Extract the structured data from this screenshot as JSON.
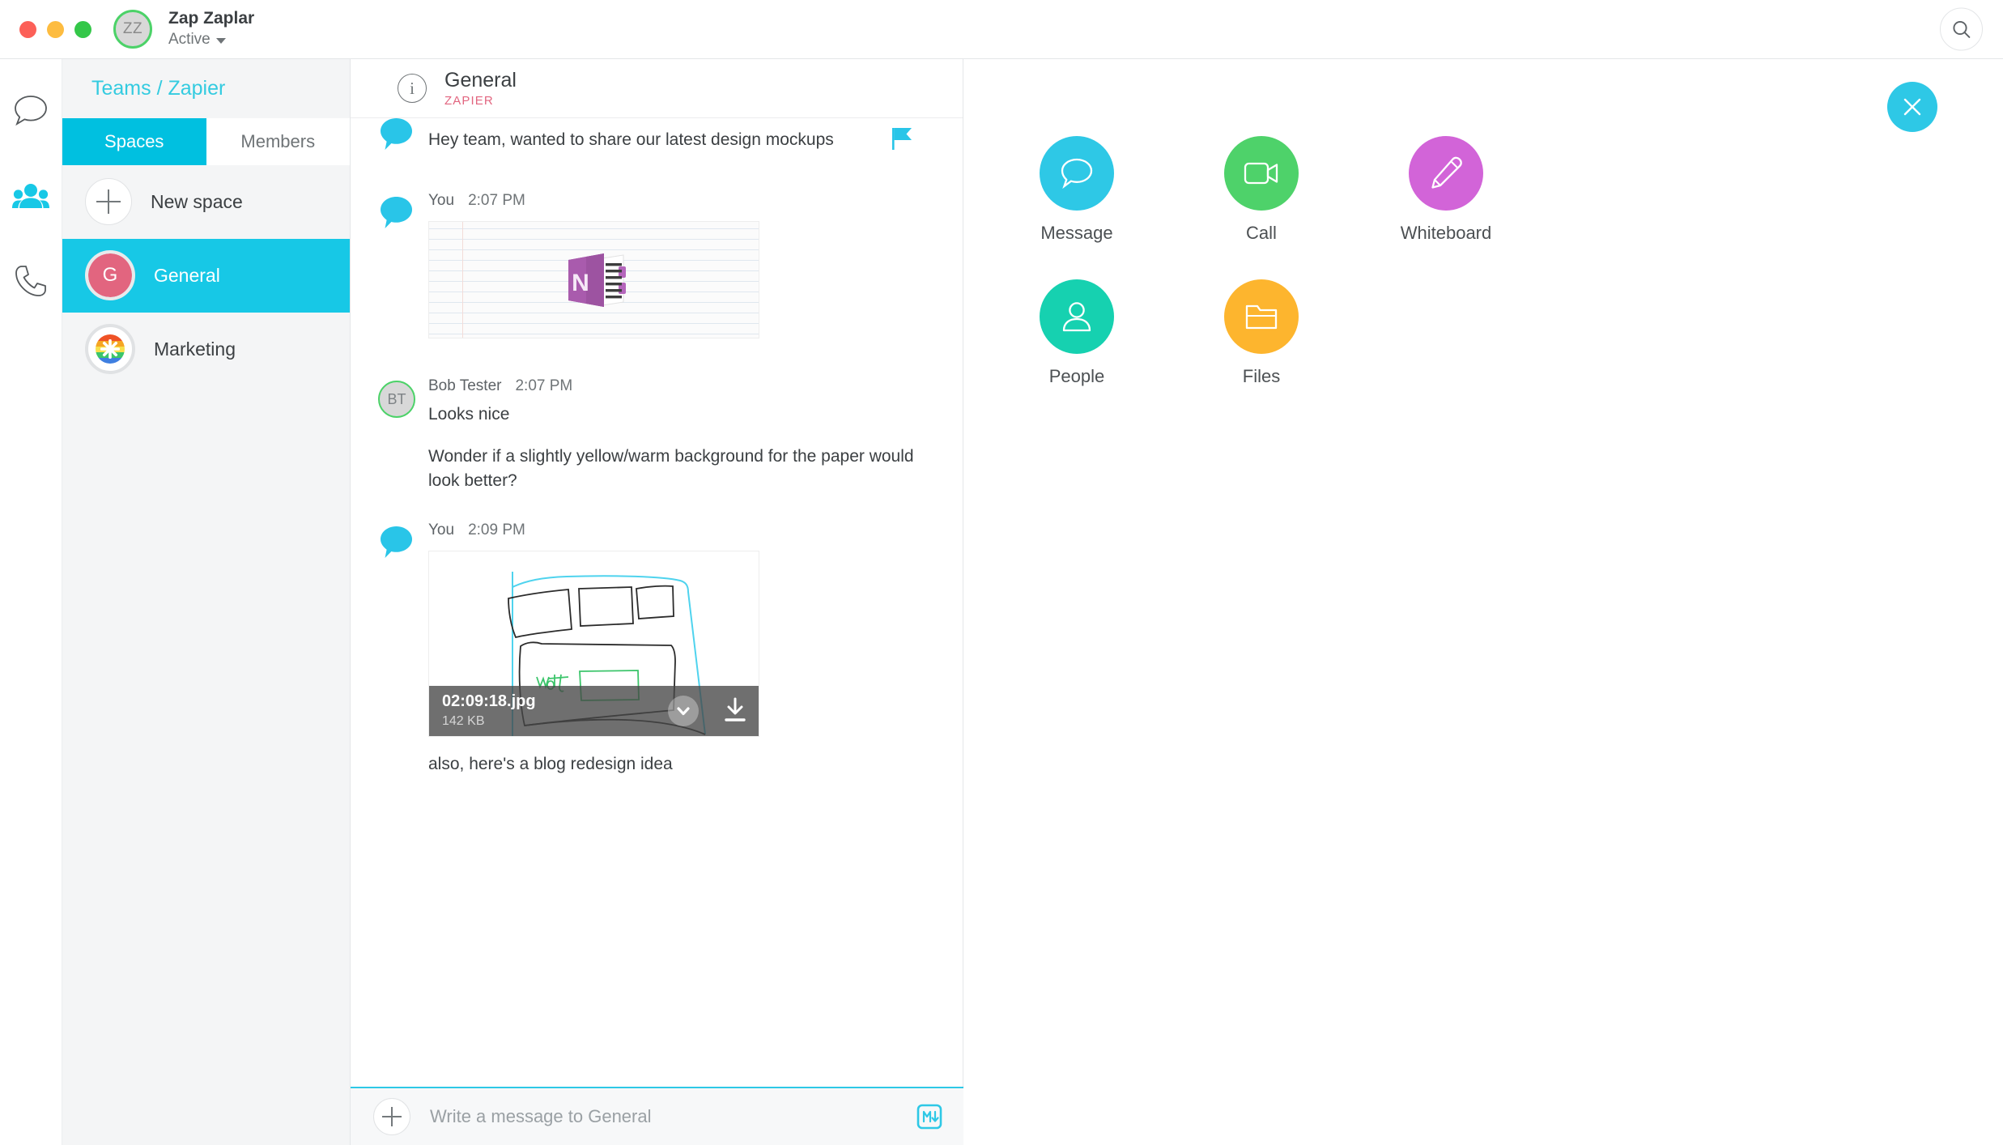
{
  "window": {
    "traffic_lights": [
      "close",
      "minimize",
      "zoom"
    ],
    "user": {
      "initials": "ZZ",
      "name": "Zap Zaplar",
      "status": "Active"
    },
    "search_icon": "search-icon"
  },
  "rail": {
    "items": [
      {
        "icon": "chat-bubble-icon",
        "name": "messages",
        "active": false
      },
      {
        "icon": "people-group-icon",
        "name": "teams",
        "active": true
      },
      {
        "icon": "phone-handset-icon",
        "name": "calls",
        "active": false
      }
    ]
  },
  "sidebar": {
    "breadcrumb": "Teams / Zapier",
    "tabs": [
      {
        "label": "Spaces",
        "active": true
      },
      {
        "label": "Members",
        "active": false
      }
    ],
    "new_space": {
      "label": "New space",
      "icon": "plus-icon"
    },
    "spaces": [
      {
        "label": "General",
        "avatar_letter": "G",
        "avatar_color": "#e2657f",
        "active": true
      },
      {
        "label": "Marketing",
        "avatar_icon": "zapier-logo-icon",
        "active": false
      }
    ]
  },
  "chat": {
    "header": {
      "info_icon": "info-icon",
      "title": "General",
      "subtitle": "ZAPIER"
    },
    "messages": [
      {
        "author": "",
        "time": "",
        "avatar_type": "bubble",
        "text": "Hey team, wanted to share our latest design mockups",
        "flagged": true,
        "flag_icon": "flag-icon"
      },
      {
        "author": "You",
        "time": "2:07 PM",
        "avatar_type": "bubble",
        "text": "",
        "attachment": {
          "kind": "onenote-thumbnail",
          "alt": "OneNote notebook page"
        }
      },
      {
        "author": "Bob Tester",
        "time": "2:07 PM",
        "avatar_type": "initials",
        "avatar_initials": "BT",
        "text": "Looks nice",
        "text2": "Wonder if a slightly yellow/warm background for the paper would look better?"
      },
      {
        "author": "You",
        "time": "2:09 PM",
        "avatar_type": "bubble",
        "attachment": {
          "kind": "whiteboard-sketch",
          "file_name": "02:09:18.jpg",
          "file_size": "142 KB",
          "expand_icon": "chevron-down-icon",
          "download_icon": "download-icon"
        }
      }
    ],
    "trailing_text": "also, here's a blog redesign idea",
    "composer": {
      "add_icon": "plus-icon",
      "placeholder": "Write a message to General",
      "value": "",
      "markdown_icon": "markdown-icon"
    }
  },
  "panel": {
    "close_icon": "close-icon",
    "actions": [
      {
        "label": "Message",
        "icon": "chat-bubble-icon",
        "color": "#2ec8e6"
      },
      {
        "label": "Call",
        "icon": "video-camera-icon",
        "color": "#4ed26a"
      },
      {
        "label": "Whiteboard",
        "icon": "pencil-icon",
        "color": "#d264d8"
      },
      {
        "label": "People",
        "icon": "person-icon",
        "color": "#16d1b0"
      },
      {
        "label": "Files",
        "icon": "folder-icon",
        "color": "#fdb52e"
      }
    ]
  },
  "colors": {
    "accent": "#2ec8e6",
    "sidebar_active": "#17c8e6",
    "breadcrumb": "#33cbe0",
    "space_badge": "#e2657f"
  }
}
